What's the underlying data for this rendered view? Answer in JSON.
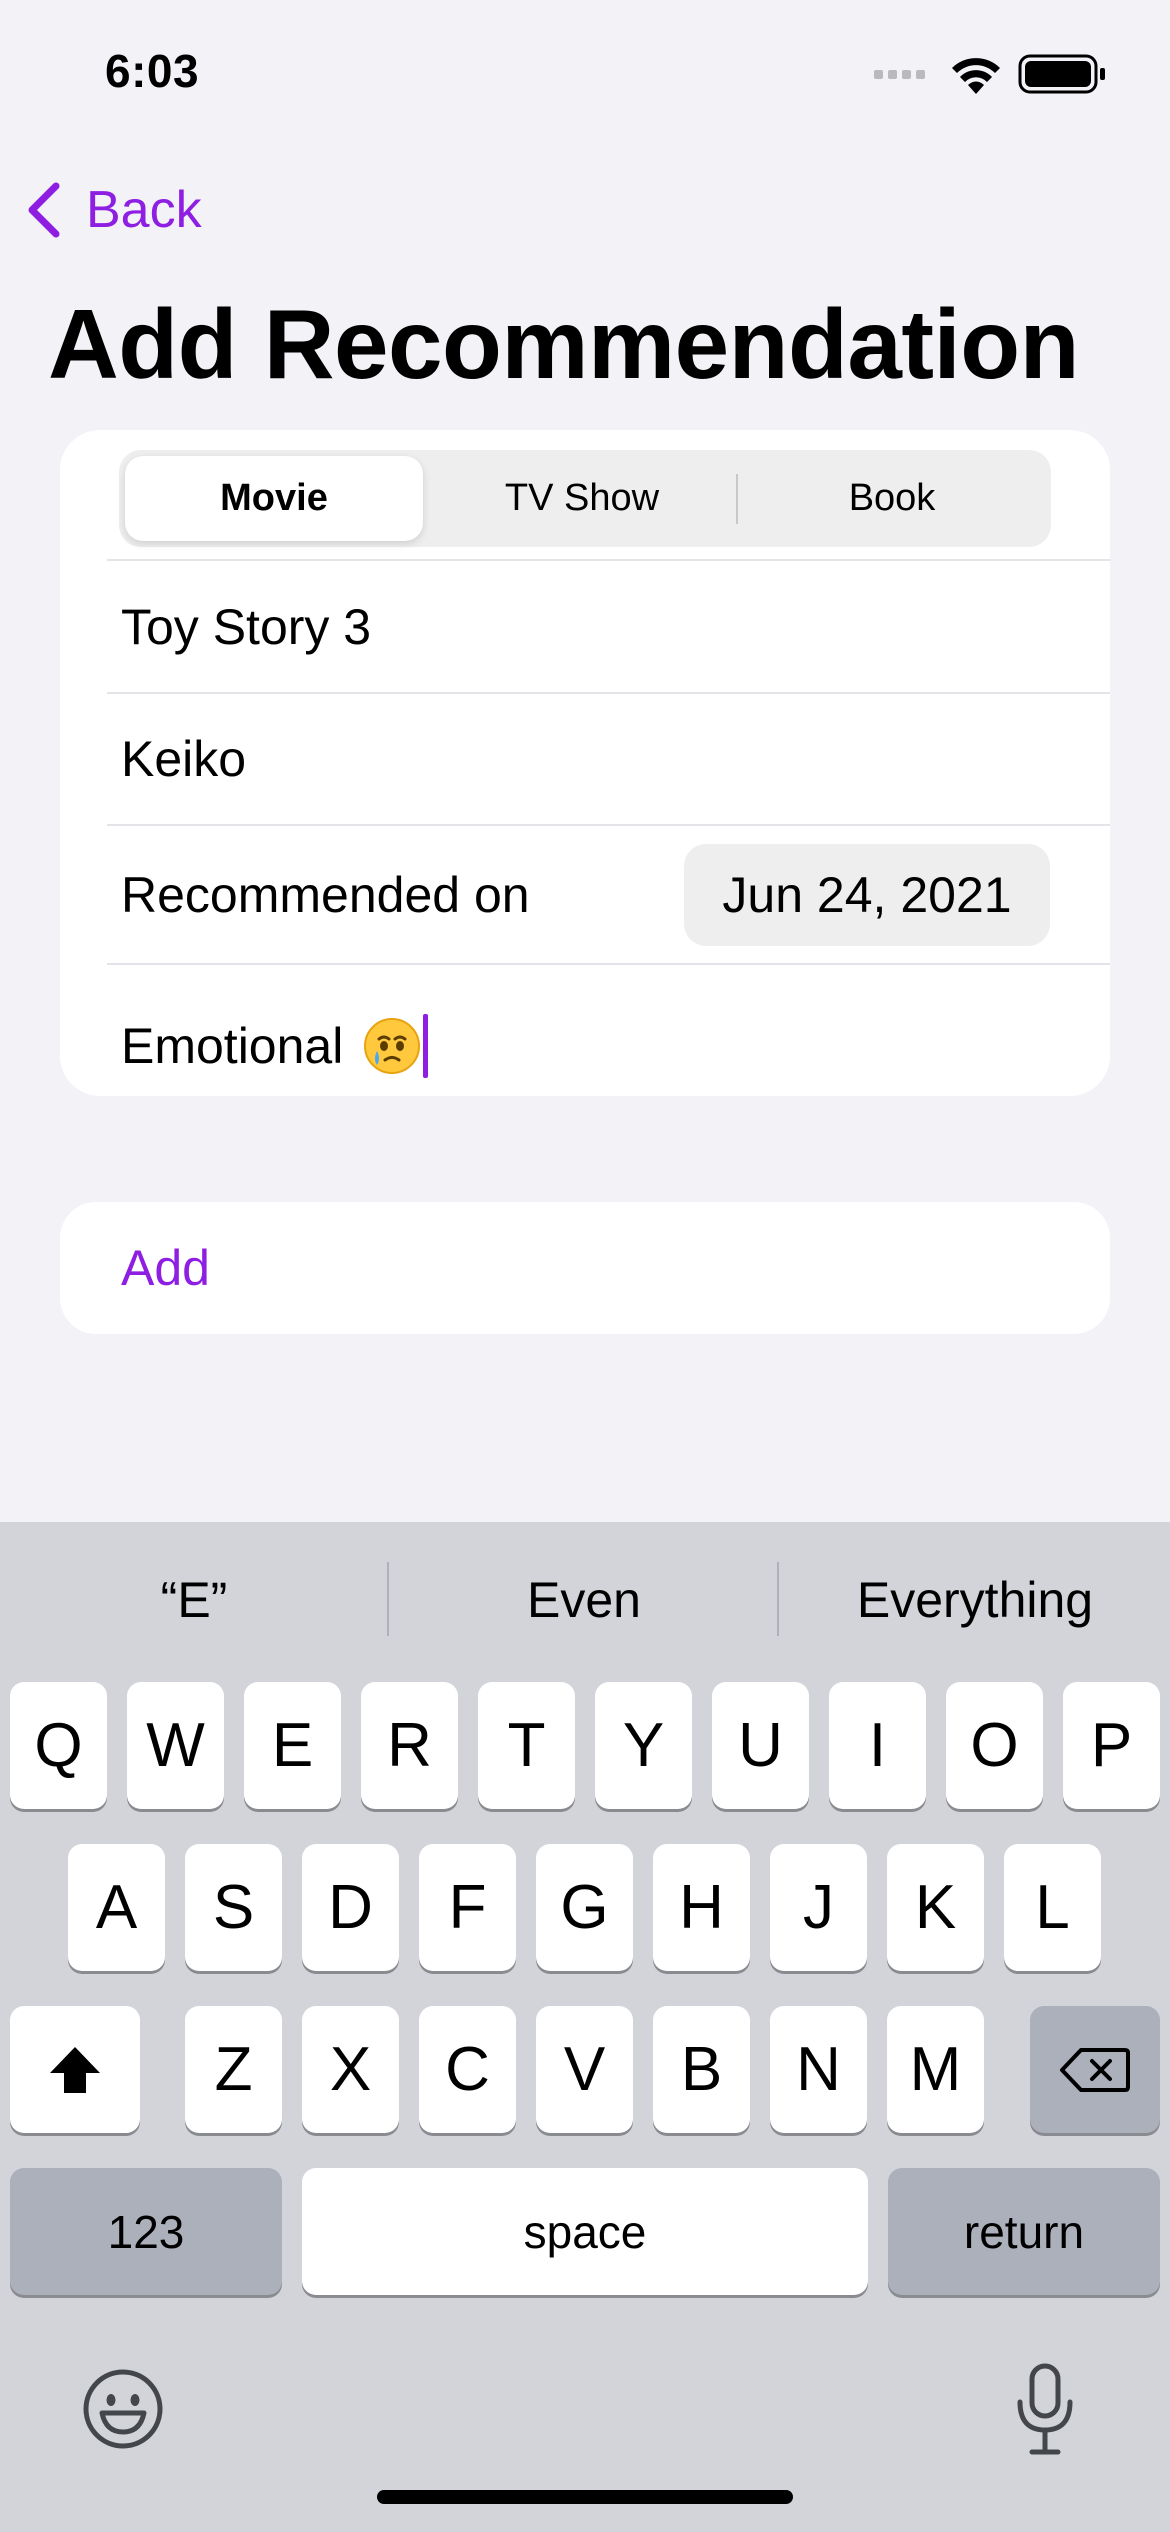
{
  "status_bar": {
    "time": "6:03"
  },
  "nav": {
    "back_label": "Back",
    "title": "Add Recommendation"
  },
  "form": {
    "segments": [
      "Movie",
      "TV Show",
      "Book"
    ],
    "selected_segment": "Movie",
    "title_value": "Toy Story 3",
    "recommender_value": "Keiko",
    "date_label": "Recommended on",
    "date_value": "Jun 24, 2021",
    "notes_value": "Emotional",
    "notes_emoji": "face-holding-back-tears"
  },
  "add_button": {
    "label": "Add"
  },
  "keyboard": {
    "suggestions": [
      "“E”",
      "Even",
      "Everything"
    ],
    "row1": [
      "Q",
      "W",
      "E",
      "R",
      "T",
      "Y",
      "U",
      "I",
      "O",
      "P"
    ],
    "row2": [
      "A",
      "S",
      "D",
      "F",
      "G",
      "H",
      "J",
      "K",
      "L"
    ],
    "row3": [
      "Z",
      "X",
      "C",
      "V",
      "B",
      "N",
      "M"
    ],
    "numbers_label": "123",
    "space_label": "space",
    "return_label": "return"
  },
  "colors": {
    "accent": "#8e1ee2",
    "background": "#f2f2f7",
    "keyboard": "#d2d4da"
  }
}
